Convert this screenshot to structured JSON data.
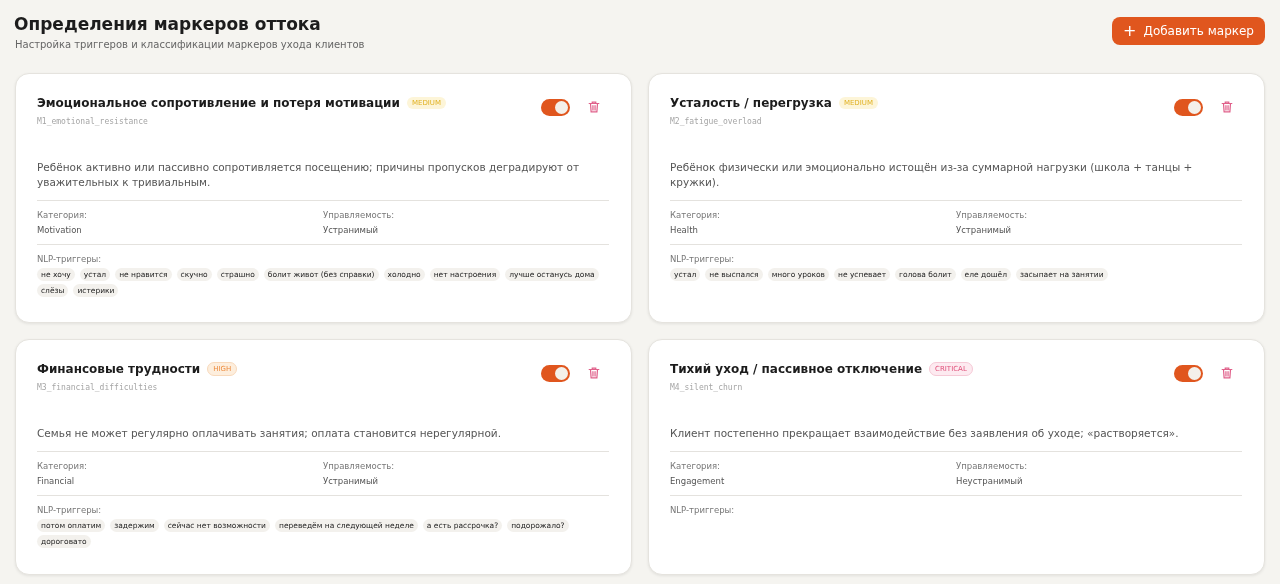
{
  "header": {
    "title": "Определения маркеров оттока",
    "subtitle": "Настройка триггеров и классификации маркеров ухода клиентов",
    "add_button": {
      "icon": "+",
      "label": "Добавить маркер"
    }
  },
  "markers": [
    {
      "title": "Эмоциональное сопротивление и потеря мотивации",
      "severity": {
        "kind": "medium",
        "label": "MEDIUM"
      },
      "code": "M1_emotional_resistance",
      "on": true,
      "description": "Ребёнок активно или пассивно сопротивляется посещению; причины пропусков деградируют от уважительных к тривиальным.",
      "category_label": "Категория:",
      "category": "Motivation",
      "control_label": "Управляемость:",
      "control": "Устранимый",
      "triggers_label": "NLP-триггеры:",
      "triggers": [
        "не хочу",
        "устал",
        "не нравится",
        "скучно",
        "страшно",
        "болит живот (без справки)",
        "холодно",
        "нет настроения",
        "лучше останусь дома",
        "слёзы",
        "истерики"
      ]
    },
    {
      "title": "Усталость / перегрузка",
      "severity": {
        "kind": "medium",
        "label": "MEDIUM"
      },
      "code": "M2_fatigue_overload",
      "on": true,
      "description": "Ребёнок физически или эмоционально истощён из-за суммарной нагрузки (школа + танцы + кружки).",
      "category_label": "Категория:",
      "category": "Health",
      "control_label": "Управляемость:",
      "control": "Устранимый",
      "triggers_label": "NLP-триггеры:",
      "triggers": [
        "устал",
        "не выспался",
        "много уроков",
        "не успевает",
        "голова болит",
        "еле дошёл",
        "засыпает на занятии"
      ]
    },
    {
      "title": "Финансовые трудности",
      "severity": {
        "kind": "high",
        "label": "HIGH"
      },
      "code": "M3_financial_difficulties",
      "on": true,
      "description": "Семья не может регулярно оплачивать занятия; оплата становится нерегулярной.",
      "category_label": "Категория:",
      "category": "Financial",
      "control_label": "Управляемость:",
      "control": "Устранимый",
      "triggers_label": "NLP-триггеры:",
      "triggers": [
        "потом оплатим",
        "задержим",
        "сейчас нет возможности",
        "переведём на следующей неделе",
        "а есть рассрочка?",
        "подорожало?",
        "дороговато"
      ]
    },
    {
      "title": "Тихий уход / пассивное отключение",
      "severity": {
        "kind": "critical",
        "label": "CRITICAL"
      },
      "code": "M4_silent_churn",
      "on": true,
      "description": "Клиент постепенно прекращает взаимодействие без заявления об уходе; «растворяется».",
      "category_label": "Категория:",
      "category": "Engagement",
      "control_label": "Управляемость:",
      "control": "Неустранимый",
      "triggers_label": "NLP-триггеры:"
    }
  ]
}
